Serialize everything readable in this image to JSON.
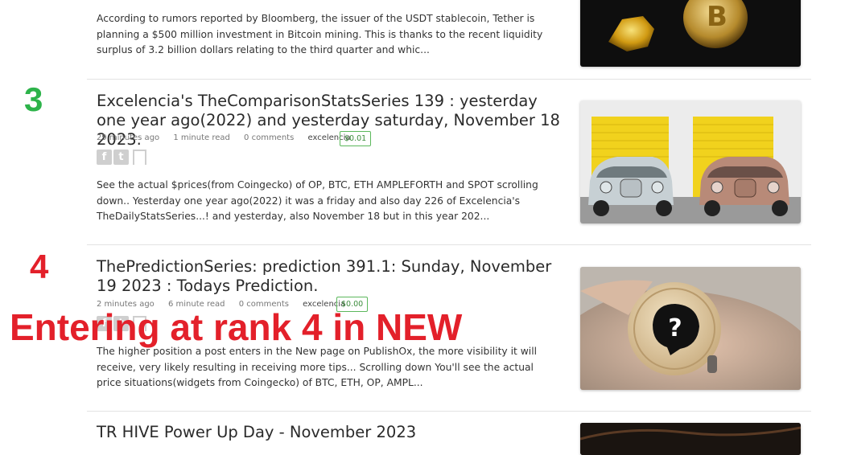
{
  "colors": {
    "rank3": "#2db34a",
    "rank4": "#e3202a",
    "overlay": "#e3202a",
    "tip_border": "#5cb85c"
  },
  "overlay": {
    "text": "Entering at rank 4 in NEW"
  },
  "top_post": {
    "excerpt": "According to rumors reported by Bloomberg, the issuer of the USDT stablecoin, Tether is planning a $500 million investment in Bitcoin mining. This is thanks to the recent liquidity surplus of 3.2 billion dollars relating to the third quarter and whic..."
  },
  "posts": [
    {
      "rank": "3",
      "title": "Excelencia's TheComparisonStatsSeries 139 : yesterday one year ago(2022) and yesterday saturday, November 18 2023.",
      "time": "29 minutes ago",
      "read": "1 minute read",
      "comments": "0 comments",
      "author": "excelencia",
      "tip": "$0.01",
      "excerpt": "See the actual $prices(from Coingecko) of OP, BTC, ETH AMPLEFORTH and SPOT scrolling down.. Yesterday one year ago(2022) it was a friday  and also day 226 of Excelencia's TheDailyStatsSeries...! and yesterday, also November 18 but in this year 202..."
    },
    {
      "rank": "4",
      "title": "ThePredictionSeries: prediction 391.1: Sunday, November 19 2023 : Todays Prediction.",
      "time": "2 minutes ago",
      "read": "6 minute read",
      "comments": "0 comments",
      "author": "excelencia",
      "tip": "$0.00",
      "excerpt": "The higher position a post enters in the New page on PublishOx, the more visibility it will receive, very likely resulting in receiving more tips... Scrolling down You'll see the actual price situations(widgets from Coingecko) of BTC, ETH, OP,  AMPL..."
    },
    {
      "title": "TR HIVE Power Up Day - November 2023"
    }
  ],
  "icons": [
    "facebook-icon",
    "twitter-icon",
    "bookmark-icon",
    "question-mark-icon"
  ]
}
